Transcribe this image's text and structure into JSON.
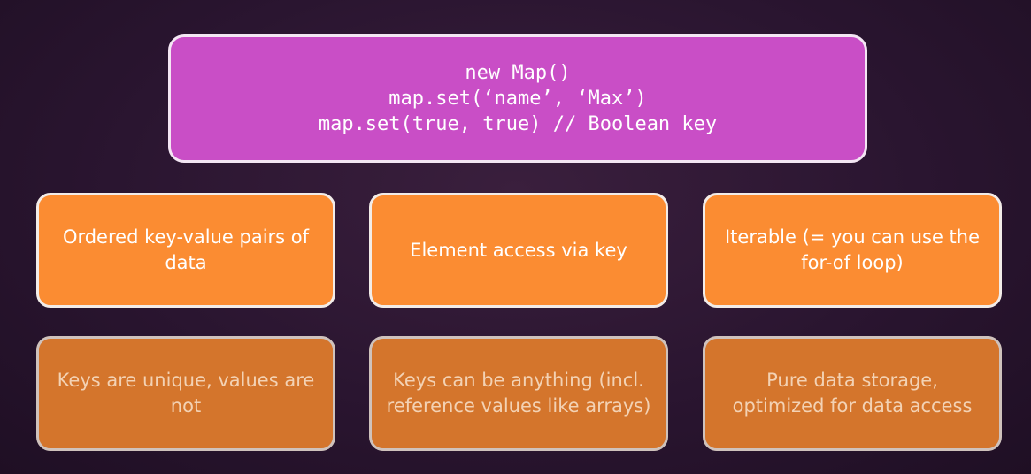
{
  "code_box": {
    "lines": [
      "new Map()",
      "map.set(‘name’, ‘Max’)",
      "map.set(true, true) // Boolean key"
    ]
  },
  "cards_top": [
    "Ordered key-value pairs of data",
    "Element access via key",
    "Iterable (= you can use the for-of loop)"
  ],
  "cards_bottom": [
    "Keys are unique, values are not",
    "Keys can be anything (incl. reference values like arrays)",
    "Pure data storage, optimized for data access"
  ],
  "colors": {
    "background": "#2a1530",
    "code_box_fill": "#c94ec6",
    "card_bright_fill": "#fb8c32",
    "card_muted_fill": "#d4752c",
    "border": "#f2ece8"
  }
}
